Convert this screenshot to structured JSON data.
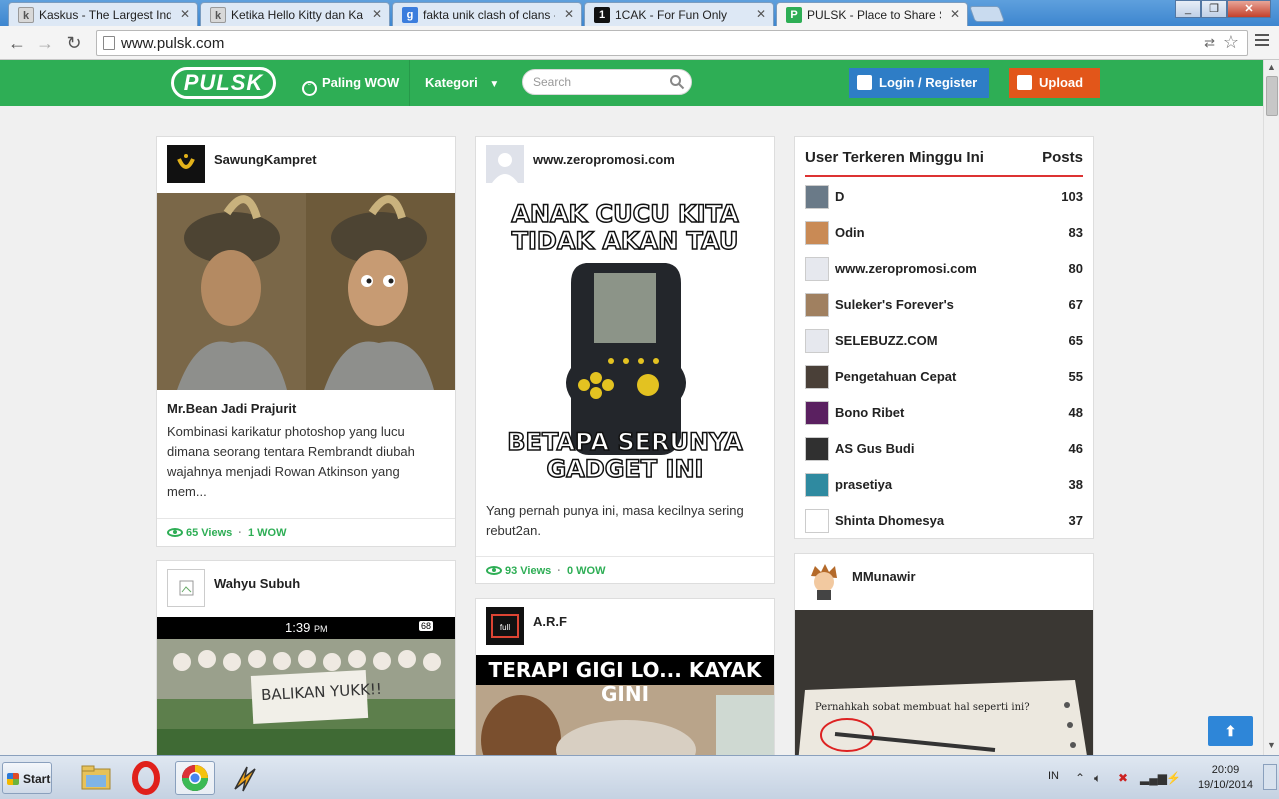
{
  "browser": {
    "tabs": [
      {
        "label": "Kaskus - The Largest Indo",
        "favicon": "kaskus-icon",
        "active": false
      },
      {
        "label": "Ketika Hello Kitty dan Kaw",
        "favicon": "kaskus-icon",
        "active": false
      },
      {
        "label": "fakta unik clash of clans -",
        "favicon": "google-icon",
        "active": false
      },
      {
        "label": "1CAK - For Fun Only",
        "favicon": "1cak-icon",
        "active": false
      },
      {
        "label": "PULSK - Place to Share So",
        "favicon": "pulsk-icon",
        "active": true
      }
    ],
    "url": "www.pulsk.com"
  },
  "header": {
    "logo": "PULSK",
    "nav": {
      "paling_wow": "Paling WOW",
      "kategori": "Kategori"
    },
    "search_placeholder": "Search",
    "login_label": "Login / Register",
    "upload_label": "Upload"
  },
  "posts": [
    {
      "author": "SawungKampret",
      "title": "Mr.Bean Jadi Prajurit",
      "description": "Kombinasi karikatur photoshop yang lucu dimana seorang tentara Rembrandt diubah wajahnya menjadi Rowan Atkinson yang mem...",
      "views": "65 Views",
      "wows": "1 WOW"
    },
    {
      "author": "Wahyu Subuh",
      "image_text": {
        "time": "1:39",
        "ampm": "PM",
        "battery": "68",
        "banner": "BALIKAN YUKK!!"
      }
    },
    {
      "author": "www.zeropromosi.com",
      "image_text": {
        "top1": "ANAK CUCU KITA",
        "top2": "TIDAK AKAN TAU",
        "bottom1": "BETAPA SERUNYA",
        "bottom2": "GADGET INI"
      },
      "description": "Yang pernah punya ini, masa kecilnya sering rebut2an.",
      "views": "93 Views",
      "wows": "0 WOW"
    },
    {
      "author": "A.R.F",
      "image_text": {
        "headline": "TERAPI GIGI LO... KAYAK GINI"
      }
    },
    {
      "author": "MMunawir",
      "image_text": {
        "note": "Pernahkah sobat membuat hal seperti ini?"
      }
    }
  ],
  "leaderboard": {
    "title": "User Terkeren Minggu Ini",
    "posts_label": "Posts",
    "users": [
      {
        "name": "D",
        "posts": "103",
        "color": "#6a7a88"
      },
      {
        "name": "Odin",
        "posts": "83",
        "color": "#c98a55"
      },
      {
        "name": "www.zeropromosi.com",
        "posts": "80",
        "color": "#e6e8ee"
      },
      {
        "name": "Suleker's Forever's",
        "posts": "67",
        "color": "#a08060"
      },
      {
        "name": "SELEBUZZ.COM",
        "posts": "65",
        "color": "#e6e8ee"
      },
      {
        "name": "Pengetahuan Cepat",
        "posts": "55",
        "color": "#4a4038"
      },
      {
        "name": "Bono Ribet",
        "posts": "48",
        "color": "#5a2060"
      },
      {
        "name": "AS Gus Budi",
        "posts": "46",
        "color": "#303030"
      },
      {
        "name": "prasetiya",
        "posts": "38",
        "color": "#2f8aa0"
      },
      {
        "name": "Shinta Dhomesya",
        "posts": "37",
        "color": "#ffffff"
      }
    ]
  },
  "taskbar": {
    "start_label": "Start",
    "language": "IN",
    "time": "20:09",
    "date": "19/10/2014"
  },
  "colors": {
    "brand_green": "#2eae55",
    "login_blue": "#2e7dc6",
    "upload_orange": "#e2561a",
    "accent_red": "#dd3333"
  }
}
